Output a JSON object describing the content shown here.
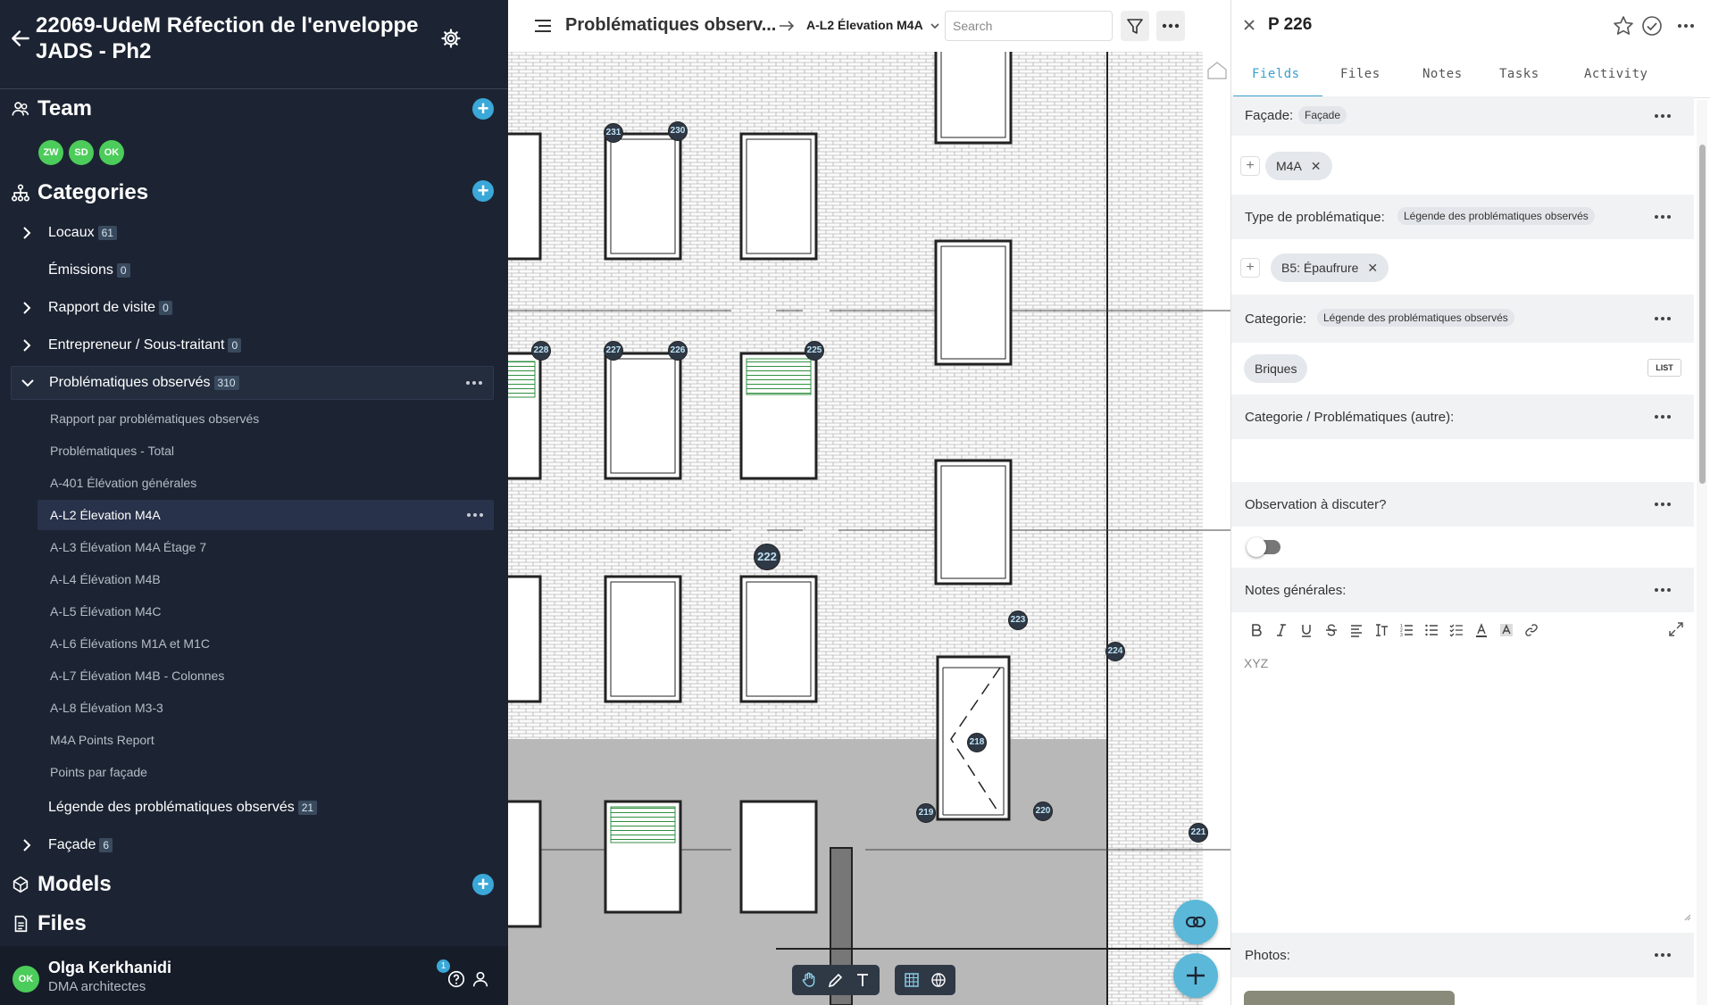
{
  "sidebar": {
    "project_title": "22069-UdeM Réfection de l'enveloppe JADS - Ph2",
    "team": {
      "title": "Team",
      "members": [
        "ZW",
        "SD",
        "OK"
      ]
    },
    "categories": {
      "title": "Categories",
      "items": [
        {
          "label": "Locaux",
          "count": "61",
          "expandable": true
        },
        {
          "label": "Émissions",
          "count": "0",
          "expandable": false
        },
        {
          "label": "Rapport de visite",
          "count": "0",
          "expandable": true
        },
        {
          "label": "Entrepreneur / Sous-traitant",
          "count": "0",
          "expandable": true
        },
        {
          "label": "Problématiques observés",
          "count": "310",
          "expandable": true,
          "expanded": true
        },
        {
          "label": "Légende des problématiques observés",
          "count": "21",
          "expandable": false
        },
        {
          "label": "Façade",
          "count": "6",
          "expandable": true
        }
      ],
      "sub_items": [
        "Rapport par problématiques observés",
        "Problématiques - Total",
        "A-401 Élévation générales",
        "A-L2 Élevation M4A",
        "A-L3 Élévation M4A Étage 7",
        "A-L4 Élévation M4B",
        "A-L5 Élévation M4C",
        "A-L6 Élévations M1A et M1C",
        "A-L7 Élévation M4B - Colonnes",
        "A-L8 Élévation M3-3",
        "M4A Points Report",
        "Points par façade"
      ],
      "active_sub_item": "A-L2 Élevation M4A"
    },
    "models": {
      "title": "Models"
    },
    "files": {
      "title": "Files"
    },
    "user": {
      "initials": "OK",
      "name": "Olga Kerkhanidi",
      "org": "DMA architectes",
      "notifications": "1"
    }
  },
  "viewer": {
    "title": "Problématiques observ...",
    "sheet": "A-L2 Élevation M4A",
    "search_placeholder": "Search",
    "pins": [
      "231",
      "230",
      "228",
      "227",
      "226",
      "225",
      "222",
      "223",
      "224",
      "218",
      "219",
      "220",
      "221"
    ]
  },
  "panel": {
    "title": "P 226",
    "tabs": [
      "Fields",
      "Files",
      "Notes",
      "Tasks",
      "Activity"
    ],
    "active_tab": "Fields",
    "fields": {
      "facade": {
        "label": "Façade:",
        "ref": "Façade",
        "value": "M4A"
      },
      "type": {
        "label": "Type de problématique:",
        "ref": "Légende des problématiques observés",
        "value": "B5: Épaufrure"
      },
      "categorie": {
        "label": "Categorie:",
        "ref": "Légende des problématiques observés",
        "value": "Briques",
        "list_label": "LIST"
      },
      "categorie_autre": {
        "label": "Categorie / Problématiques (autre):"
      },
      "observation": {
        "label": "Observation à discuter?",
        "value": false
      },
      "notes": {
        "label": "Notes générales:",
        "text": "XYZ"
      },
      "photos": {
        "label": "Photos:"
      }
    }
  },
  "colors": {
    "sidebar_bg": "#1c2433",
    "accent": "#3aa8d8",
    "avatar_green": "#4ccc5a",
    "pin_bg": "#2f3946"
  }
}
